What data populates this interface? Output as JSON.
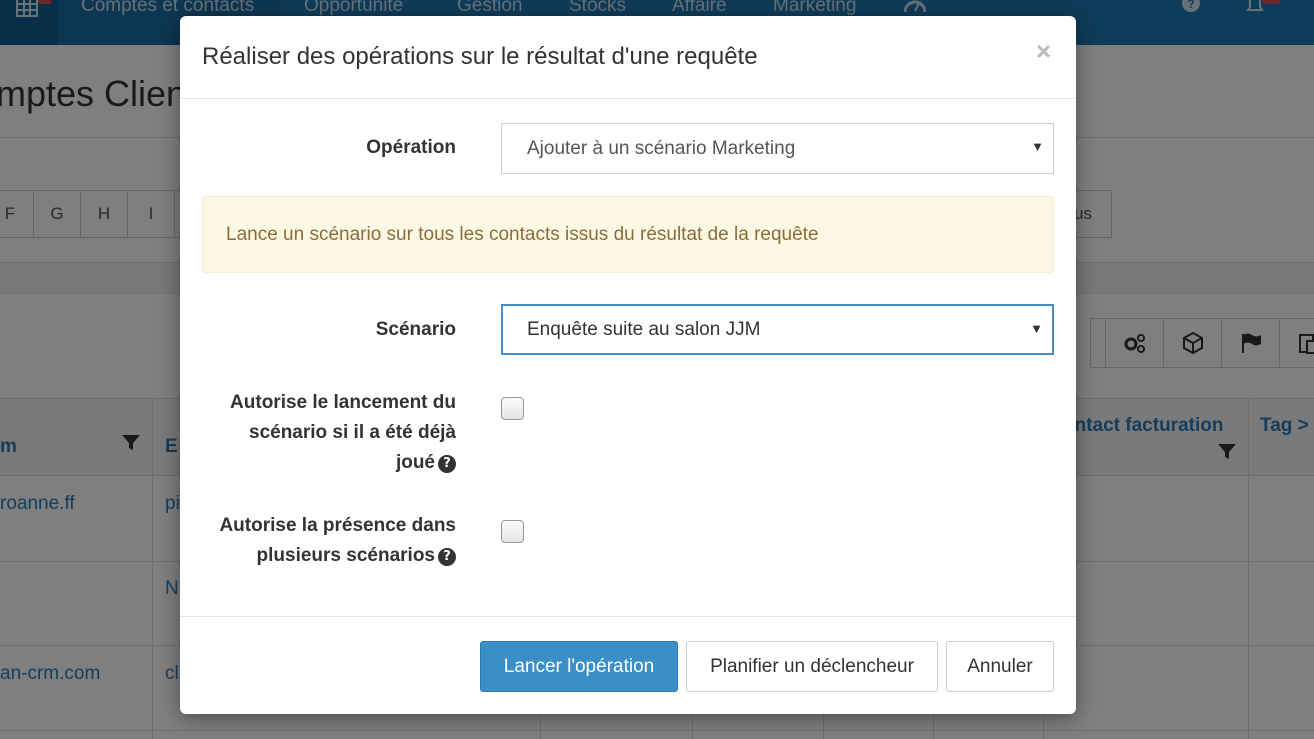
{
  "background": {
    "nav": {
      "items": [
        "Comptes et contacts",
        "Opportunité",
        "Gestion",
        "Stocks",
        "Affaire",
        "Marketing"
      ]
    },
    "page_title": "mptes Client",
    "letters": [
      "F",
      "G",
      "H",
      "I"
    ],
    "letter_tail": "us",
    "table": {
      "headers": [
        "m",
        "E",
        "ontact facturation",
        "Tag >"
      ],
      "cells": [
        "roanne.ff",
        "pi",
        "N",
        "an-crm.com",
        "cl"
      ]
    }
  },
  "modal": {
    "title": "Réaliser des opérations sur le résultat d'une requête",
    "close_label": "×",
    "operation": {
      "label": "Opération",
      "value": "Ajouter à un scénario Marketing"
    },
    "alert": "Lance un scénario sur tous les contacts issus du résultat de la requête",
    "scenario": {
      "label": "Scénario",
      "value": "Enquête suite au salon JJM"
    },
    "allow_replay": {
      "label_line1": "Autorise le lancement du",
      "label_line2": "scénario si il a été déjà",
      "label_line3": "joué",
      "checked": false
    },
    "allow_multiple": {
      "label_line1": "Autorise la présence dans",
      "label_line2": "plusieurs scénarios",
      "checked": false
    },
    "buttons": {
      "launch": "Lancer l'opération",
      "schedule": "Planifier un déclencheur",
      "cancel": "Annuler"
    }
  }
}
